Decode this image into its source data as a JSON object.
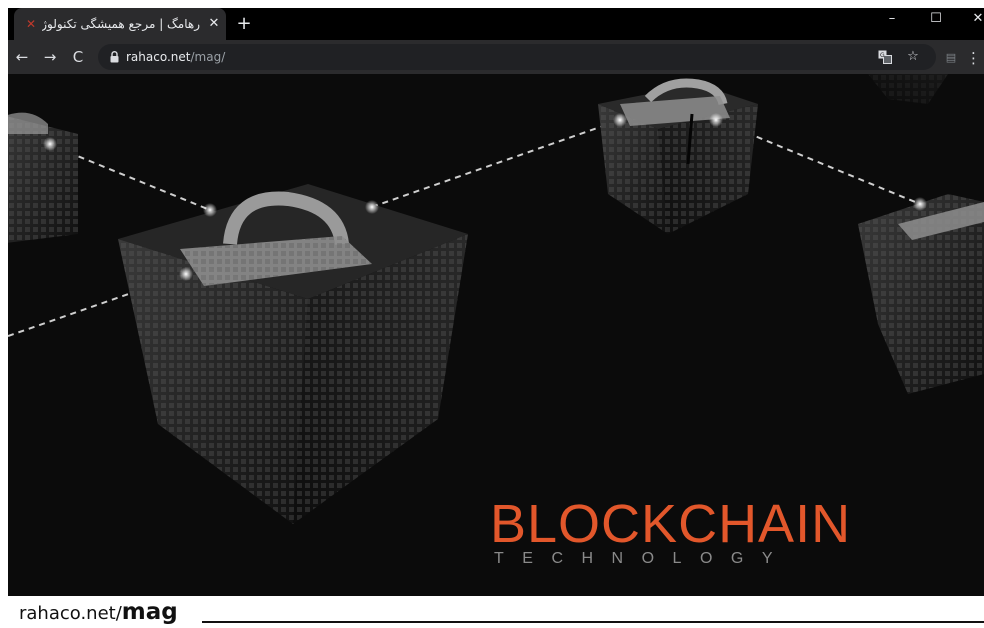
{
  "browser": {
    "tab": {
      "title": "رهامگ | مرجع همیشگی تکنولوژی |",
      "favicon_icon": "rahaco-favicon-icon",
      "close_label": "✕"
    },
    "new_tab_label": "+",
    "window_controls": {
      "minimize": "–",
      "maximize": "☐",
      "close": "✕"
    },
    "toolbar": {
      "back": "←",
      "forward": "→",
      "reload": "C",
      "menu": "⋮"
    },
    "address_bar": {
      "host": "rahaco.net",
      "path": "/mag/",
      "secure_icon": "lock-icon",
      "translate_icon": "translate-icon",
      "bookmark": "☆",
      "extension_icon": "extension-icon"
    }
  },
  "page": {
    "headline": "BLOCKCHAIN",
    "subheadline": "TECHNOLOGY",
    "headline_color": "#e2572b",
    "background_color": "#0b0b0b",
    "illustration": "padlocked-data-cubes-linked-by-dashed-lines"
  },
  "caption": {
    "host": "rahaco.net/",
    "path": "mag"
  }
}
